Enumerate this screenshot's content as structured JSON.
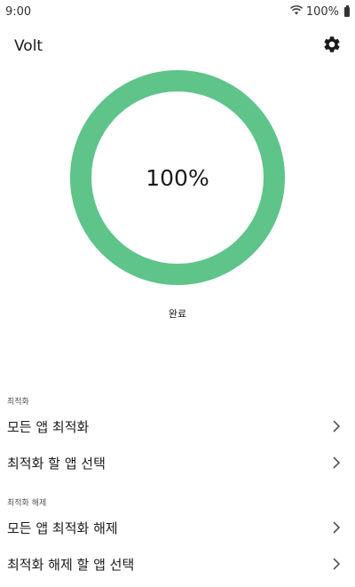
{
  "status_bar": {
    "time": "9:00",
    "battery_text": "100%",
    "icons": [
      "wifi-icon",
      "battery-icon"
    ]
  },
  "app_bar": {
    "title": "Volt",
    "settings_icon": "gear-icon"
  },
  "gauge": {
    "percent_text": "100%",
    "percent_value": 100,
    "status_label": "완료",
    "color": "#5ec489"
  },
  "sections": [
    {
      "header": "최적화",
      "items": [
        {
          "label": "모든 앱 최적화"
        },
        {
          "label": "최적화 할 앱 선택"
        }
      ]
    },
    {
      "header": "최적화 해제",
      "items": [
        {
          "label": "모든 앱 최적화 해제"
        },
        {
          "label": "최적화 해제 할 앱 선택"
        }
      ]
    }
  ]
}
